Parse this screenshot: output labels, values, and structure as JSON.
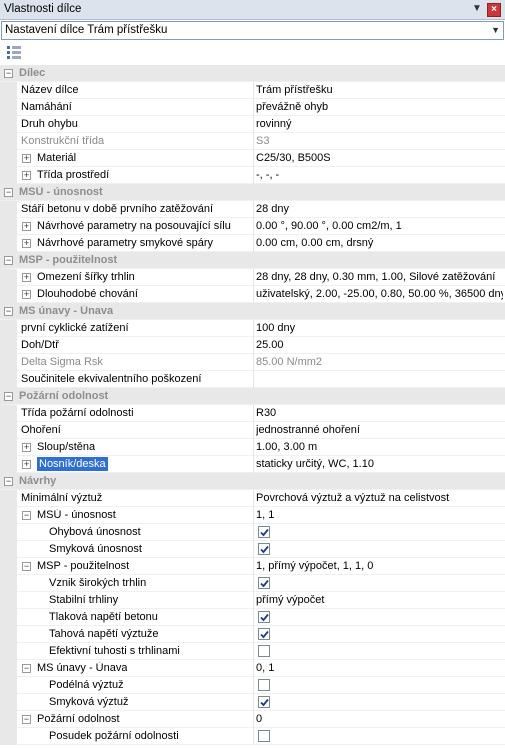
{
  "window": {
    "title": "Vlastnosti dílce",
    "pin_icon": "pin-icon",
    "close_icon": "close-icon",
    "close_glyph": "×"
  },
  "selector": {
    "value": "Nastavení dílce Trám přístřešku"
  },
  "toolbar": {
    "icon": "properties-grid-icon"
  },
  "rows": [
    {
      "kind": "cat",
      "expander": "minus",
      "label": "Dílec"
    },
    {
      "kind": "prop",
      "indent": 0,
      "label": "Název dílce",
      "value": "Trám přístřešku"
    },
    {
      "kind": "prop",
      "indent": 0,
      "label": "Namáhání",
      "value": "převážně ohyb"
    },
    {
      "kind": "prop",
      "indent": 0,
      "label": "Druh ohybu",
      "value": "rovinný"
    },
    {
      "kind": "prop",
      "indent": 0,
      "label": "Konstrukční třída",
      "value": "S3",
      "gray": true
    },
    {
      "kind": "prop",
      "indent": 0,
      "expander": "plus",
      "label": "Materiál",
      "value": "C25/30, B500S"
    },
    {
      "kind": "prop",
      "indent": 0,
      "expander": "plus",
      "label": "Třída prostředí",
      "value": "-, -, -"
    },
    {
      "kind": "cat",
      "expander": "minus",
      "label": "MSÚ - únosnost"
    },
    {
      "kind": "prop",
      "indent": 0,
      "label": "Stáří betonu v době prvního zatěžování",
      "value": "28 dny"
    },
    {
      "kind": "prop",
      "indent": 0,
      "expander": "plus",
      "label": "Návrhové parametry na posouvající sílu",
      "value": "0.00 °, 90.00 °, 0.00 cm2/m, 1"
    },
    {
      "kind": "prop",
      "indent": 0,
      "expander": "plus",
      "label": "Návrhové parametry smykové spáry",
      "value": "0.00 cm, 0.00 cm, drsný"
    },
    {
      "kind": "cat",
      "expander": "minus",
      "label": "MSP - použitelnost"
    },
    {
      "kind": "prop",
      "indent": 0,
      "expander": "plus",
      "label": "Omezení šířky trhlin",
      "value": "28 dny, 28 dny, 0.30 mm, 1.00, Silové zatěžování"
    },
    {
      "kind": "prop",
      "indent": 0,
      "expander": "plus",
      "label": "Dlouhodobé chování",
      "value": "uživatelský, 2.00, -25.00, 0.80, 50.00 %, 36500 dny"
    },
    {
      "kind": "cat",
      "expander": "minus",
      "label": "MS únavy - Únava"
    },
    {
      "kind": "prop",
      "indent": 0,
      "label": "první cyklické zatížení",
      "value": "100 dny"
    },
    {
      "kind": "prop",
      "indent": 0,
      "label": "Doh/Dtř",
      "value": "25.00"
    },
    {
      "kind": "prop",
      "indent": 0,
      "label": "Delta Sigma Rsk",
      "value": "85.00 N/mm2",
      "gray": true
    },
    {
      "kind": "prop",
      "indent": 0,
      "label": "Součinitele ekvivalentního poškození",
      "value": ""
    },
    {
      "kind": "cat",
      "expander": "minus",
      "label": "Požární odolnost"
    },
    {
      "kind": "prop",
      "indent": 0,
      "label": "Třída požární odolnosti",
      "value": "R30"
    },
    {
      "kind": "prop",
      "indent": 0,
      "label": "Ohoření",
      "value": "jednostranné ohoření"
    },
    {
      "kind": "prop",
      "indent": 0,
      "expander": "plus",
      "label": "Sloup/stěna",
      "value": "1.00, 3.00 m"
    },
    {
      "kind": "prop",
      "indent": 0,
      "expander": "plus",
      "label": "Nosník/deska",
      "value": "staticky určitý, WC, 1.10",
      "selected": true
    },
    {
      "kind": "cat",
      "expander": "minus",
      "label": "Návrhy"
    },
    {
      "kind": "prop",
      "indent": 0,
      "label": "Minimální výztuž",
      "value": "Povrchová výztuž a výztuž na celistvost"
    },
    {
      "kind": "prop",
      "indent": 0,
      "expander": "minus",
      "label": "MSÚ - únosnost",
      "value": "1, 1"
    },
    {
      "kind": "prop",
      "indent": 2,
      "label": "Ohybová únosnost",
      "checkbox": true
    },
    {
      "kind": "prop",
      "indent": 2,
      "label": "Smyková únosnost",
      "checkbox": true
    },
    {
      "kind": "prop",
      "indent": 0,
      "expander": "minus",
      "label": "MSP - použitelnost",
      "value": "1, přímý výpočet, 1, 1, 0"
    },
    {
      "kind": "prop",
      "indent": 2,
      "label": "Vznik širokých trhlin",
      "checkbox": true
    },
    {
      "kind": "prop",
      "indent": 2,
      "label": "Stabilní trhliny",
      "value": "přímý výpočet"
    },
    {
      "kind": "prop",
      "indent": 2,
      "label": "Tlaková napětí betonu",
      "checkbox": true
    },
    {
      "kind": "prop",
      "indent": 2,
      "label": "Tahová napětí výztuže",
      "checkbox": true
    },
    {
      "kind": "prop",
      "indent": 2,
      "label": "Efektivní tuhosti s trhlinami",
      "checkbox": false
    },
    {
      "kind": "prop",
      "indent": 0,
      "expander": "minus",
      "label": "MS únavy - Únava",
      "value": "0, 1"
    },
    {
      "kind": "prop",
      "indent": 2,
      "label": "Podélná výztuž",
      "checkbox": false
    },
    {
      "kind": "prop",
      "indent": 2,
      "label": "Smyková výztuž",
      "checkbox": true
    },
    {
      "kind": "prop",
      "indent": 0,
      "expander": "minus",
      "label": "Požární odolnost",
      "value": "0"
    },
    {
      "kind": "prop",
      "indent": 2,
      "label": "Posudek požární odolnosti",
      "checkbox": false
    }
  ]
}
